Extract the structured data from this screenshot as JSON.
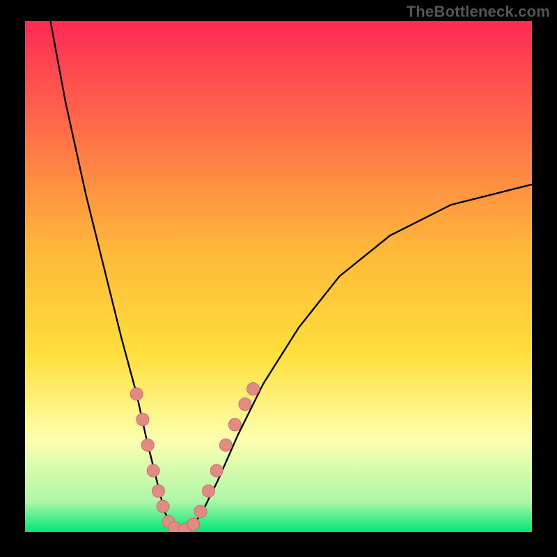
{
  "watermark": {
    "text": "TheBottleneck.com"
  },
  "colors": {
    "black": "#000000",
    "curve": "#000000",
    "marker_fill": "#e28b85",
    "marker_stroke": "#c96e68",
    "grad_top": "#ff2a55",
    "grad_mid": "#ffdf3a",
    "grad_lowband": "#fdffb0",
    "grad_bottom": "#00e676"
  },
  "chart_data": {
    "type": "line",
    "title": "",
    "xlabel": "",
    "ylabel": "",
    "xlim": [
      0,
      100
    ],
    "ylim": [
      0,
      100
    ],
    "gradient_stops": [
      {
        "y": 100,
        "color": "#ff2a55"
      },
      {
        "y": 55,
        "color": "#ffb93a"
      },
      {
        "y": 35,
        "color": "#ffdf3a"
      },
      {
        "y": 18,
        "color": "#fdffb0"
      },
      {
        "y": 6,
        "color": "#adf7a8"
      },
      {
        "y": 0,
        "color": "#00e676"
      }
    ],
    "series": [
      {
        "name": "bottleneck-curve",
        "x": [
          5,
          8,
          12,
          16,
          19,
          22,
          24,
          26,
          27.5,
          29,
          31,
          33,
          35,
          38,
          42,
          47,
          54,
          62,
          72,
          84,
          100
        ],
        "y": [
          100,
          84,
          66,
          50,
          38,
          27,
          18,
          10,
          4,
          1,
          0,
          1,
          4,
          10,
          19,
          29,
          40,
          50,
          58,
          64,
          68
        ]
      }
    ],
    "markers": {
      "name": "highlighted-points",
      "points": [
        {
          "x": 22,
          "y": 27
        },
        {
          "x": 23.2,
          "y": 22
        },
        {
          "x": 24.2,
          "y": 17
        },
        {
          "x": 25.3,
          "y": 12
        },
        {
          "x": 26.3,
          "y": 8
        },
        {
          "x": 27.2,
          "y": 5
        },
        {
          "x": 28.3,
          "y": 2
        },
        {
          "x": 29.5,
          "y": 0.8
        },
        {
          "x": 31.5,
          "y": 0.5
        },
        {
          "x": 33.2,
          "y": 1.5
        },
        {
          "x": 34.6,
          "y": 4
        },
        {
          "x": 36.2,
          "y": 8
        },
        {
          "x": 37.8,
          "y": 12
        },
        {
          "x": 39.6,
          "y": 17
        },
        {
          "x": 41.4,
          "y": 21
        },
        {
          "x": 43.4,
          "y": 25
        },
        {
          "x": 45.0,
          "y": 28
        }
      ]
    }
  }
}
